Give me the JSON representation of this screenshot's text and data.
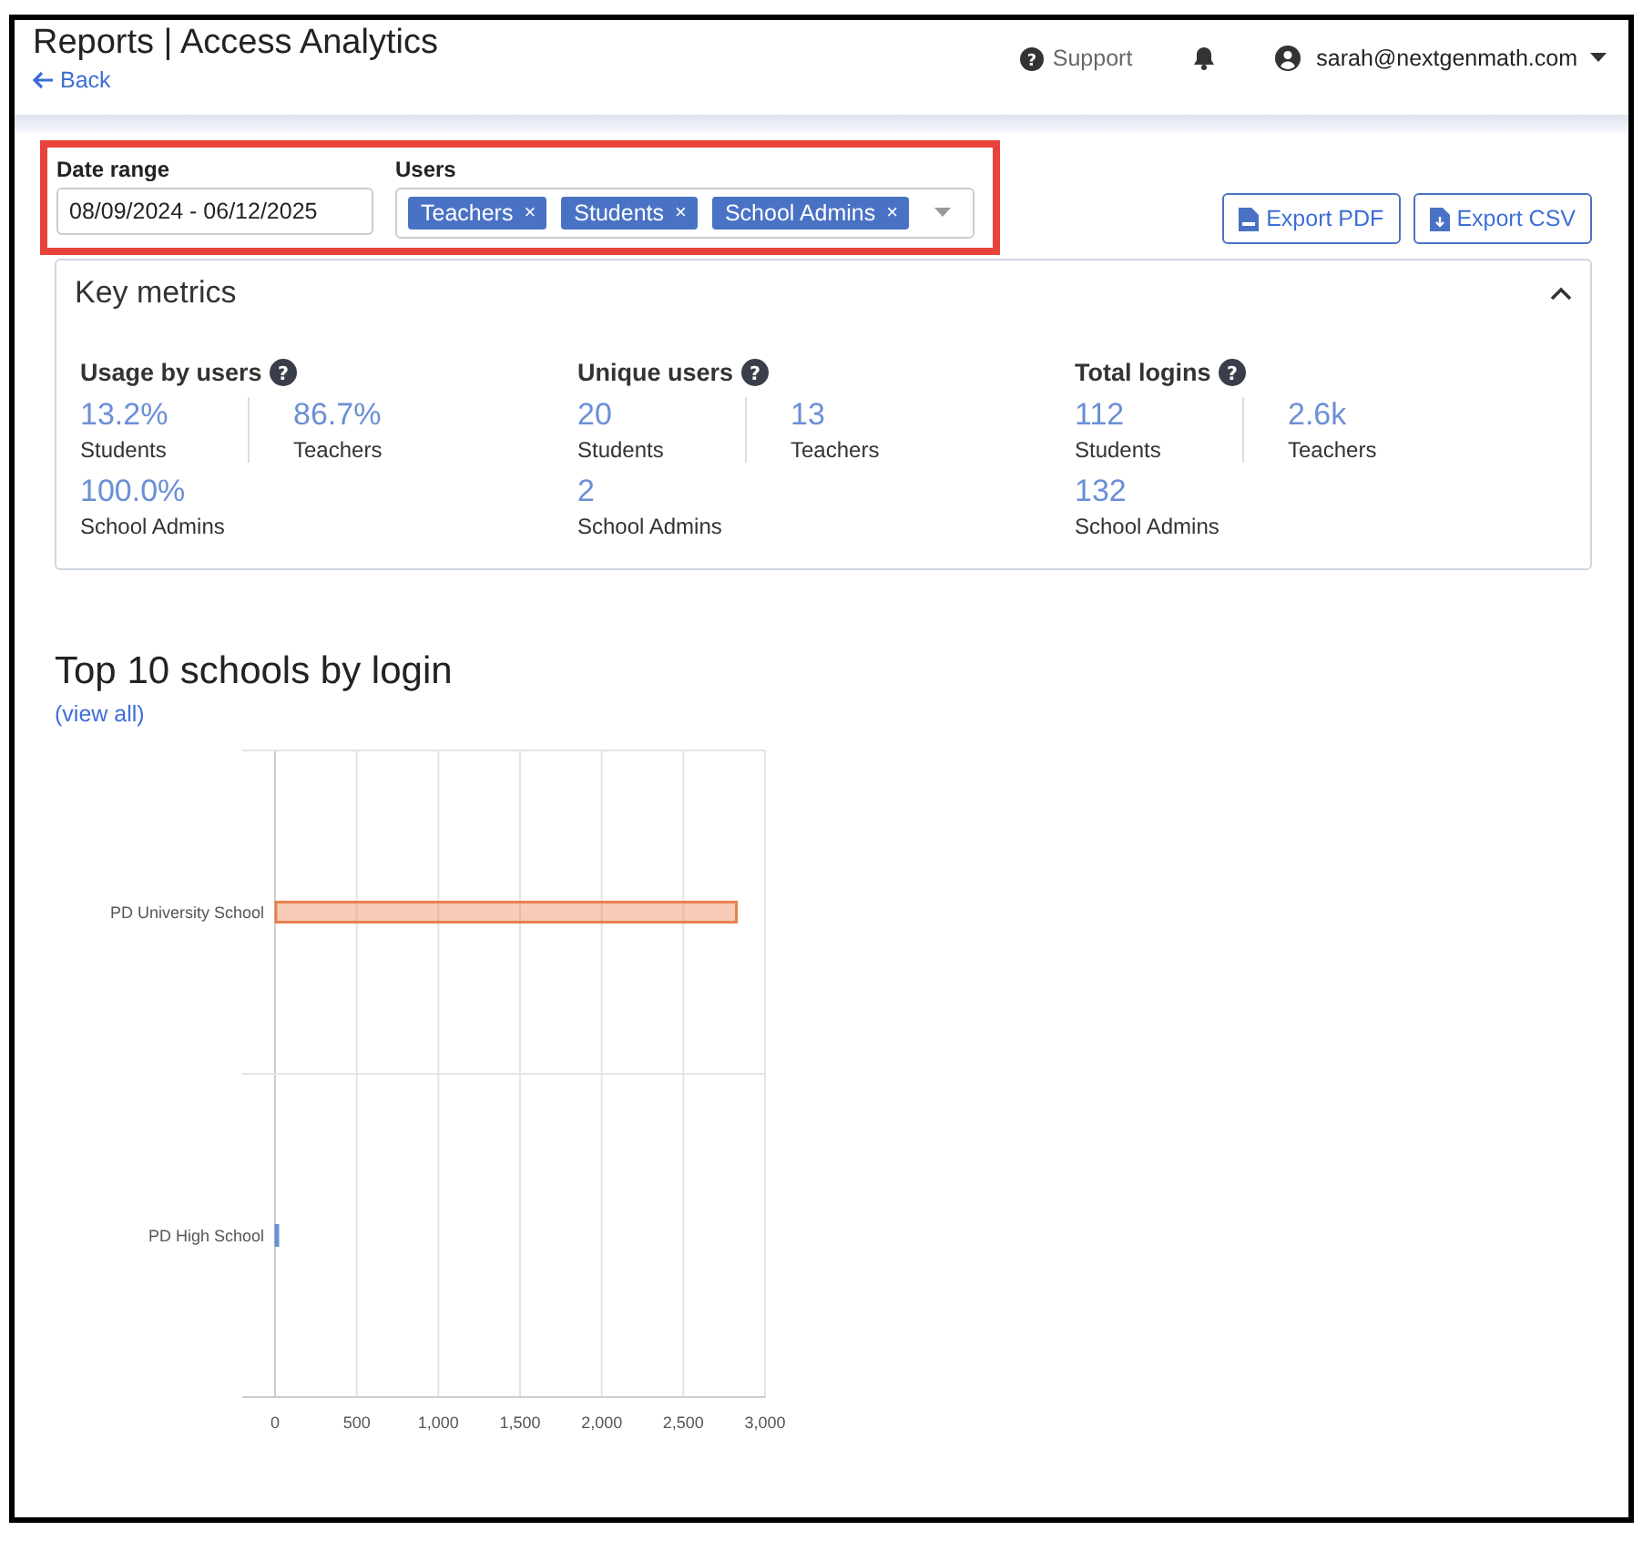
{
  "header": {
    "title": "Reports | Access Analytics",
    "back": "Back",
    "support": "Support",
    "user": "sarah@nextgenmath.com"
  },
  "filters": {
    "highlighted": true,
    "date_label": "Date range",
    "date_value": "08/09/2024 - 06/12/2025",
    "users_label": "Users",
    "users": [
      "Teachers",
      "Students",
      "School Admins"
    ],
    "remove": "×"
  },
  "exports": [
    "Export PDF",
    "Export CSV"
  ],
  "metrics": {
    "title": "Key metrics",
    "expanded": true,
    "groups": [
      {
        "title": "Usage by users",
        "items": [
          {
            "value": "13.2%",
            "label": "Students"
          },
          {
            "value": "86.7%",
            "label": "Teachers"
          },
          {
            "value": "100.0%",
            "label": "School Admins"
          }
        ]
      },
      {
        "title": "Unique users",
        "items": [
          {
            "value": "20",
            "label": "Students"
          },
          {
            "value": "13",
            "label": "Teachers"
          },
          {
            "value": "2",
            "label": "School Admins"
          }
        ]
      },
      {
        "title": "Total logins",
        "items": [
          {
            "value": "112",
            "label": "Students"
          },
          {
            "value": "2.6k",
            "label": "Teachers"
          },
          {
            "value": "132",
            "label": "School Admins"
          }
        ]
      }
    ]
  },
  "help_mark": "?",
  "top_schools": {
    "title": "Top 10 schools by login",
    "paren_open": "(",
    "view_all": "view all",
    "paren_close": ")",
    "chart_data": {
      "type": "bar",
      "orientation": "horizontal",
      "stacked": true,
      "grid": true,
      "categories": [
        "PD University School",
        "PD High School"
      ],
      "series": [
        {
          "color": "#e8804f",
          "values": [
            2830,
            null
          ]
        },
        {
          "color": "#6b8fd6",
          "values": [
            null,
            10
          ]
        }
      ],
      "xlim": [
        0,
        3000
      ],
      "xticks": [
        {
          "value": 0,
          "label": "0"
        },
        {
          "value": 500,
          "label": "500"
        },
        {
          "value": 1000,
          "label": "1,000"
        },
        {
          "value": 1500,
          "label": "1,500"
        },
        {
          "value": 2000,
          "label": "2,000"
        },
        {
          "value": 2500,
          "label": "2,500"
        },
        {
          "value": 3000,
          "label": "3,000"
        }
      ]
    }
  }
}
